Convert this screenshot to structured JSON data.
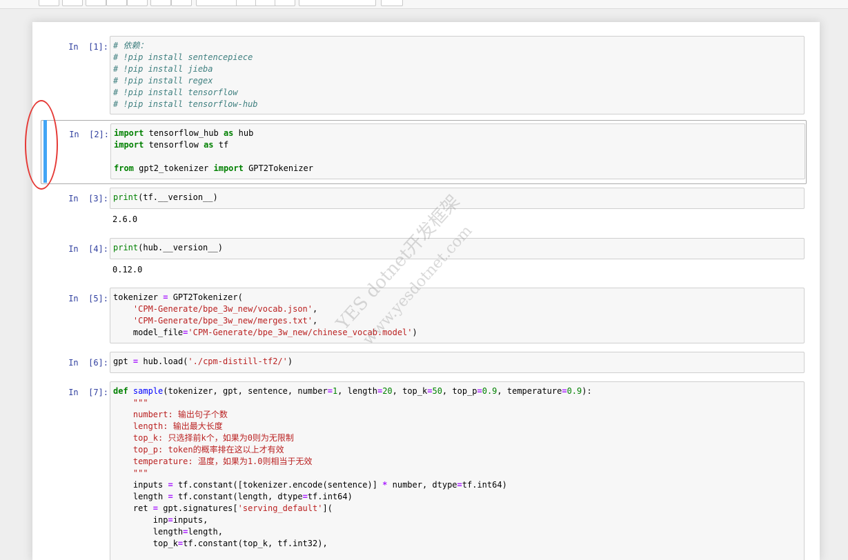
{
  "watermark": {
    "line1": "YES dotnet开发框架",
    "line2": "www.yesdotnet.com"
  },
  "cells": [
    {
      "prompt": "In  [1]:",
      "lines": [
        [
          [
            "# 依赖：",
            "cm"
          ]
        ],
        [
          [
            "# !pip install sentencepiece",
            "cm"
          ]
        ],
        [
          [
            "# !pip install jieba",
            "cm"
          ]
        ],
        [
          [
            "# !pip install regex",
            "cm"
          ]
        ],
        [
          [
            "# !pip install tensorflow",
            "cm"
          ]
        ],
        [
          [
            "# !pip install tensorflow-hub",
            "cm"
          ]
        ]
      ]
    },
    {
      "prompt": "In  [2]:",
      "lines": [
        [
          [
            "import",
            "kw"
          ],
          [
            " tensorflow_hub ",
            ""
          ],
          [
            "as",
            "kw"
          ],
          [
            " hub",
            ""
          ]
        ],
        [
          [
            "import",
            "kw"
          ],
          [
            " tensorflow ",
            ""
          ],
          [
            "as",
            "kw"
          ],
          [
            " tf",
            ""
          ]
        ],
        [
          [
            "",
            ""
          ]
        ],
        [
          [
            "from",
            "kw"
          ],
          [
            " gpt2_tokenizer ",
            ""
          ],
          [
            "import",
            "kw"
          ],
          [
            " GPT2Tokenizer",
            ""
          ]
        ]
      ]
    },
    {
      "prompt": "In  [3]:",
      "lines": [
        [
          [
            "print",
            "bi"
          ],
          [
            "(tf.__version__)",
            ""
          ]
        ]
      ],
      "output": "2.6.0"
    },
    {
      "prompt": "In  [4]:",
      "lines": [
        [
          [
            "print",
            "bi"
          ],
          [
            "(hub.__version__)",
            ""
          ]
        ]
      ],
      "output": "0.12.0"
    },
    {
      "prompt": "In  [5]:",
      "lines": [
        [
          [
            "tokenizer ",
            ""
          ],
          [
            "=",
            "op"
          ],
          [
            " GPT2Tokenizer(",
            ""
          ]
        ],
        [
          [
            "    ",
            ""
          ],
          [
            "'CPM-Generate/bpe_3w_new/vocab.json'",
            "st"
          ],
          [
            ",",
            ""
          ]
        ],
        [
          [
            "    ",
            ""
          ],
          [
            "'CPM-Generate/bpe_3w_new/merges.txt'",
            "st"
          ],
          [
            ",",
            ""
          ]
        ],
        [
          [
            "    model_file",
            ""
          ],
          [
            "=",
            "op"
          ],
          [
            "'CPM-Generate/bpe_3w_new/chinese_vocab.model'",
            "st"
          ],
          [
            ")",
            ""
          ]
        ]
      ]
    },
    {
      "prompt": "In  [6]:",
      "lines": [
        [
          [
            "gpt ",
            ""
          ],
          [
            "=",
            "op"
          ],
          [
            " hub.load(",
            ""
          ],
          [
            "'./cpm-distill-tf2/'",
            "st"
          ],
          [
            ")",
            ""
          ]
        ]
      ]
    },
    {
      "prompt": "In  [7]:",
      "lines": [
        [
          [
            "def",
            "kw"
          ],
          [
            " ",
            ""
          ],
          [
            "sample",
            "fn"
          ],
          [
            "(tokenizer, gpt, sentence, number",
            ""
          ],
          [
            "=",
            "op"
          ],
          [
            "1",
            "nm"
          ],
          [
            ", length",
            ""
          ],
          [
            "=",
            "op"
          ],
          [
            "20",
            "nm"
          ],
          [
            ", top_k",
            ""
          ],
          [
            "=",
            "op"
          ],
          [
            "50",
            "nm"
          ],
          [
            ", top_p",
            ""
          ],
          [
            "=",
            "op"
          ],
          [
            "0.9",
            "nm"
          ],
          [
            ", temperature",
            ""
          ],
          [
            "=",
            "op"
          ],
          [
            "0.9",
            "nm"
          ],
          [
            "):",
            ""
          ]
        ],
        [
          [
            "    ",
            ""
          ],
          [
            "\"\"\"",
            "ds"
          ]
        ],
        [
          [
            "    ",
            ""
          ],
          [
            "numbert: 输出句子个数",
            "ds"
          ]
        ],
        [
          [
            "    ",
            ""
          ],
          [
            "length: 输出最大长度",
            "ds"
          ]
        ],
        [
          [
            "    ",
            ""
          ],
          [
            "top_k: 只选择前k个，如果为0则为无限制",
            "ds"
          ]
        ],
        [
          [
            "    ",
            ""
          ],
          [
            "top_p: token的概率排在这以上才有效",
            "ds"
          ]
        ],
        [
          [
            "    ",
            ""
          ],
          [
            "temperature: 温度，如果为1.0则相当于无效",
            "ds"
          ]
        ],
        [
          [
            "    ",
            ""
          ],
          [
            "\"\"\"",
            "ds"
          ]
        ],
        [
          [
            "    inputs ",
            ""
          ],
          [
            "=",
            "op"
          ],
          [
            " tf.constant([tokenizer.encode(sentence)] ",
            ""
          ],
          [
            "*",
            "op"
          ],
          [
            " number, dtype",
            ""
          ],
          [
            "=",
            "op"
          ],
          [
            "tf.int64)",
            ""
          ]
        ],
        [
          [
            "    length ",
            ""
          ],
          [
            "=",
            "op"
          ],
          [
            " tf.constant(length, dtype",
            ""
          ],
          [
            "=",
            "op"
          ],
          [
            "tf.int64)",
            ""
          ]
        ],
        [
          [
            "    ret ",
            ""
          ],
          [
            "=",
            "op"
          ],
          [
            " gpt.signatures[",
            ""
          ],
          [
            "'serving_default'",
            "st"
          ],
          [
            "](",
            ""
          ]
        ],
        [
          [
            "        inp",
            ""
          ],
          [
            "=",
            "op"
          ],
          [
            "inputs,",
            ""
          ]
        ],
        [
          [
            "        length",
            ""
          ],
          [
            "=",
            "op"
          ],
          [
            "length,",
            ""
          ]
        ],
        [
          [
            "        top_k",
            ""
          ],
          [
            "=",
            "op"
          ],
          [
            "tf.constant(top_k, tf.int32),",
            ""
          ]
        ]
      ]
    }
  ]
}
